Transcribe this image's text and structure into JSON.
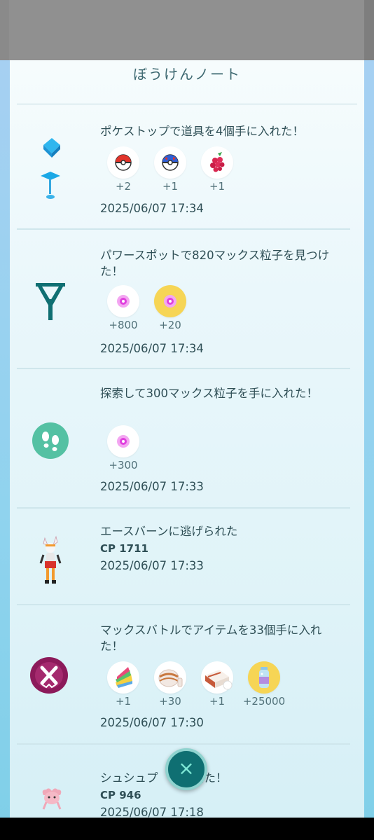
{
  "header": {
    "title": "ぼうけんノート"
  },
  "entries": [
    {
      "text": "ポケストップで道具を4個手に入れた！",
      "icon": "pokestop-icon",
      "items": [
        {
          "icon": "poke-ball-icon",
          "count": "+2"
        },
        {
          "icon": "great-ball-icon",
          "count": "+1"
        },
        {
          "icon": "razz-berry-icon",
          "count": "+1"
        }
      ],
      "date": "2025/06/07 17:34"
    },
    {
      "text": "パワースポットで820マックス粒子を見つけた！",
      "icon": "power-spot-icon",
      "items": [
        {
          "icon": "max-particle-icon",
          "count": "+800"
        },
        {
          "icon": "max-particle-bonus-icon",
          "count": "+20"
        }
      ],
      "date": "2025/06/07 17:34"
    },
    {
      "text": "探索して300マックス粒子を手に入れた！",
      "icon": "footprints-icon",
      "items": [
        {
          "icon": "max-particle-icon",
          "count": "+300"
        }
      ],
      "date": "2025/06/07 17:33"
    },
    {
      "text": "エースバーンに逃げられた",
      "icon": "cinderace-icon",
      "cp": "CP 1711",
      "date": "2025/06/07 17:33"
    },
    {
      "text": "マックスバトルでアイテムを33個手に入れた！",
      "icon": "max-battle-icon",
      "items": [
        {
          "icon": "rare-candy-icon",
          "count": "+1"
        },
        {
          "icon": "max-mushroom-icon",
          "count": "+30"
        },
        {
          "icon": "candy-xl-icon",
          "count": "+1"
        },
        {
          "icon": "stardust-icon",
          "count": "+25000"
        }
      ],
      "date": "2025/06/07 17:30"
    },
    {
      "text": "シュシュプ　　　えた！",
      "icon": "spritzee-icon",
      "cp": "CP 946",
      "date": "2025/06/07 17:18"
    }
  ],
  "close_button": {
    "icon": "close-icon"
  },
  "colors": {
    "panel": "#eaf7fb",
    "text": "#2f4f56",
    "accent": "#0f6f72",
    "gold": "#f6d555"
  }
}
